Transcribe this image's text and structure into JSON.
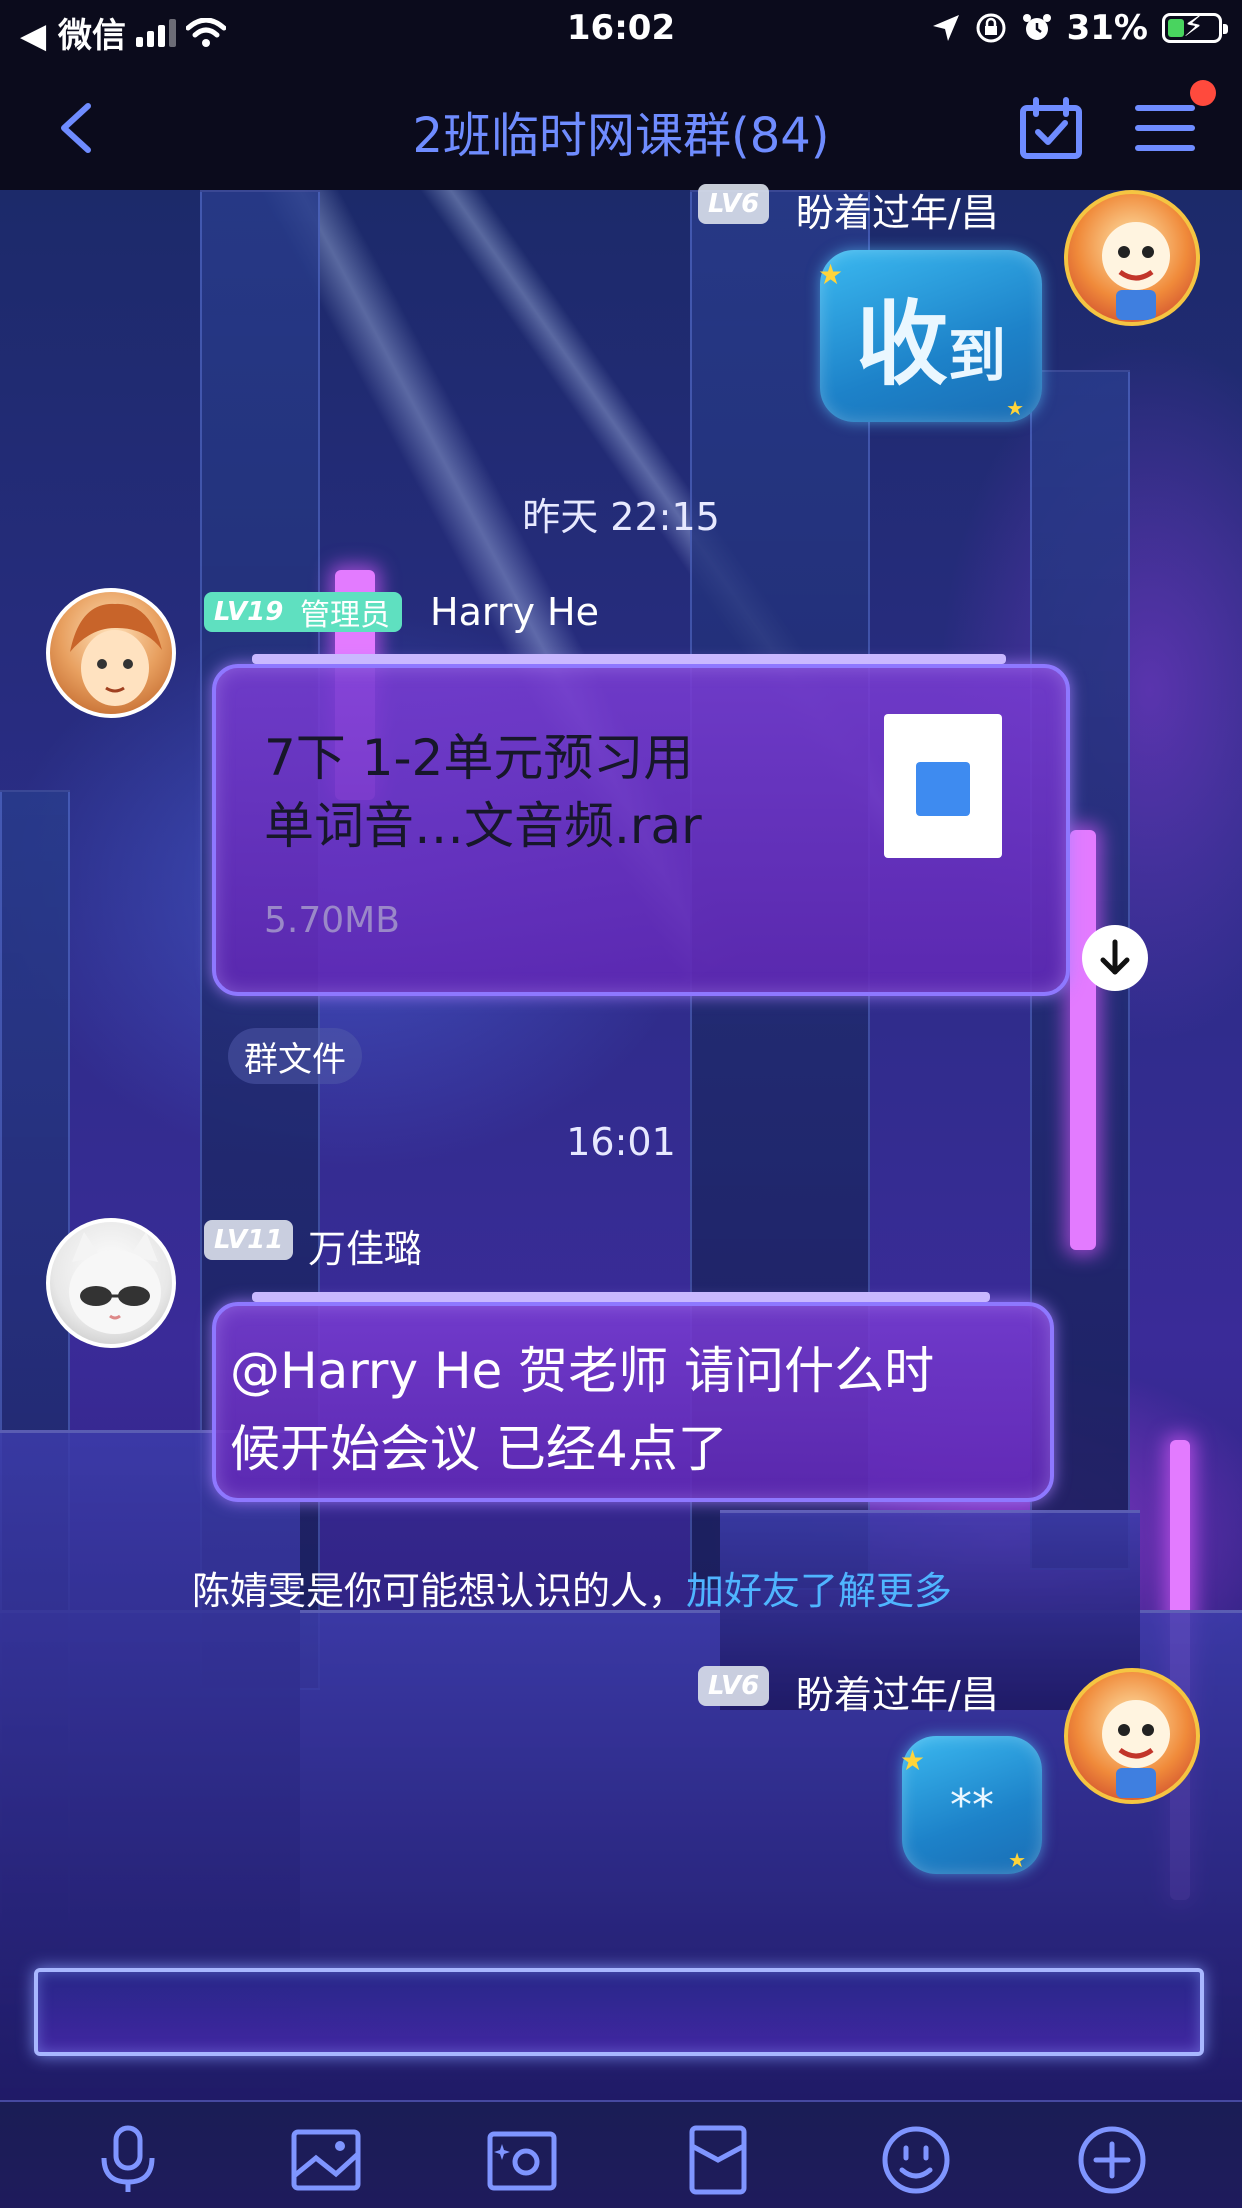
{
  "status_bar": {
    "back_app": "◀ 微信",
    "time": "16:02",
    "battery": "31%"
  },
  "nav": {
    "title": "2班临时网课群(84)"
  },
  "messages": {
    "top_name": "盼着过年/昌",
    "top_level": "LV6",
    "top_bubble_big": "收",
    "top_bubble_small": "到",
    "time1": "昨天 22:15",
    "harry_level": "LV19",
    "harry_role": "管理员",
    "harry_name": "Harry He",
    "file_title_line1": "7下 1-2单元预习用",
    "file_title_line2": "单词音…文音频.rar",
    "file_size": "5.70MB",
    "group_file_tag": "群文件",
    "time2": "16:01",
    "wan_level": "LV11",
    "wan_name": "万佳璐",
    "wan_text_line1": "@Harry He 贺老师 请问什么时",
    "wan_text_line2": "候开始会议 已经4点了",
    "suggest_text": "陈婧雯是你可能想认识的人，",
    "suggest_link": "加好友了解更多",
    "bottom_name": "盼着过年/昌",
    "bottom_level": "LV6",
    "bottom_bubble": "**"
  },
  "input": {
    "placeholder": ""
  },
  "toolbar": {
    "icons": [
      "microphone-icon",
      "image-icon",
      "camera-icon",
      "red-packet-icon",
      "emoji-icon",
      "plus-icon"
    ]
  },
  "colors": {
    "nav_title": "#6f8cff",
    "link": "#4fb5ff",
    "notification_dot": "#ff4a3d",
    "battery_green": "#49d45f",
    "admin_badge": "#5fe0c0"
  }
}
